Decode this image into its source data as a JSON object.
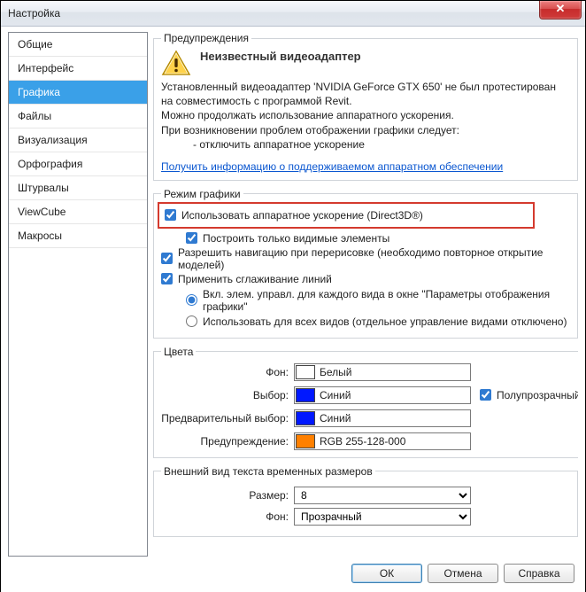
{
  "window": {
    "title": "Настройка"
  },
  "sidebar": {
    "items": [
      {
        "label": "Общие"
      },
      {
        "label": "Интерфейс"
      },
      {
        "label": "Графика"
      },
      {
        "label": "Файлы"
      },
      {
        "label": "Визуализация"
      },
      {
        "label": "Орфография"
      },
      {
        "label": "Штурвалы"
      },
      {
        "label": "ViewCube"
      },
      {
        "label": "Макросы"
      }
    ],
    "selected_index": 2
  },
  "warnings": {
    "legend": "Предупреждения",
    "title": "Неизвестный видеоадаптер",
    "line1": "Установленный видеоадаптер 'NVIDIA GeForce GTX 650' не был протестирован на совместимость с программой Revit.",
    "line2": "Можно продолжать использование аппаратного ускорения.",
    "line3": "При возникновении проблем отображении графики следует:",
    "line4": "- отключить аппаратное ускорение",
    "link": "Получить информацию о поддерживаемом аппаратном обеспечении"
  },
  "graphics_mode": {
    "legend": "Режим графики",
    "hw_accel": {
      "label": "Использовать аппаратное ускорение (Direct3D®)",
      "checked": true
    },
    "visible_only": {
      "label": "Построить только видимые элементы",
      "checked": true
    },
    "nav_redraw": {
      "label": "Разрешить навигацию при перерисовке (необходимо повторное открытие моделей)",
      "checked": true
    },
    "antialias": {
      "label": "Применить сглаживание линий",
      "checked": true
    },
    "radio_per_view": "Вкл. элем. управл. для каждого вида в окне \"Параметры отображения графики\"",
    "radio_all_views": "Использовать для всех видов (отдельное управление видами отключено)",
    "radio_selected": "per_view"
  },
  "colors": {
    "legend": "Цвета",
    "background_label": "Фон:",
    "background_value": "Белый",
    "selection_label": "Выбор:",
    "selection_value": "Синий",
    "semitransparent": {
      "label": "Полупрозрачный",
      "checked": true
    },
    "preselection_label": "Предварительный выбор:",
    "preselection_value": "Синий",
    "alert_label": "Предупреждение:",
    "alert_value": "RGB 255-128-000"
  },
  "temp_text": {
    "legend": "Внешний вид текста временных размеров",
    "size_label": "Размер:",
    "size_value": "8",
    "bg_label": "Фон:",
    "bg_value": "Прозрачный"
  },
  "buttons": {
    "ok": "ОК",
    "cancel": "Отмена",
    "help": "Справка"
  }
}
